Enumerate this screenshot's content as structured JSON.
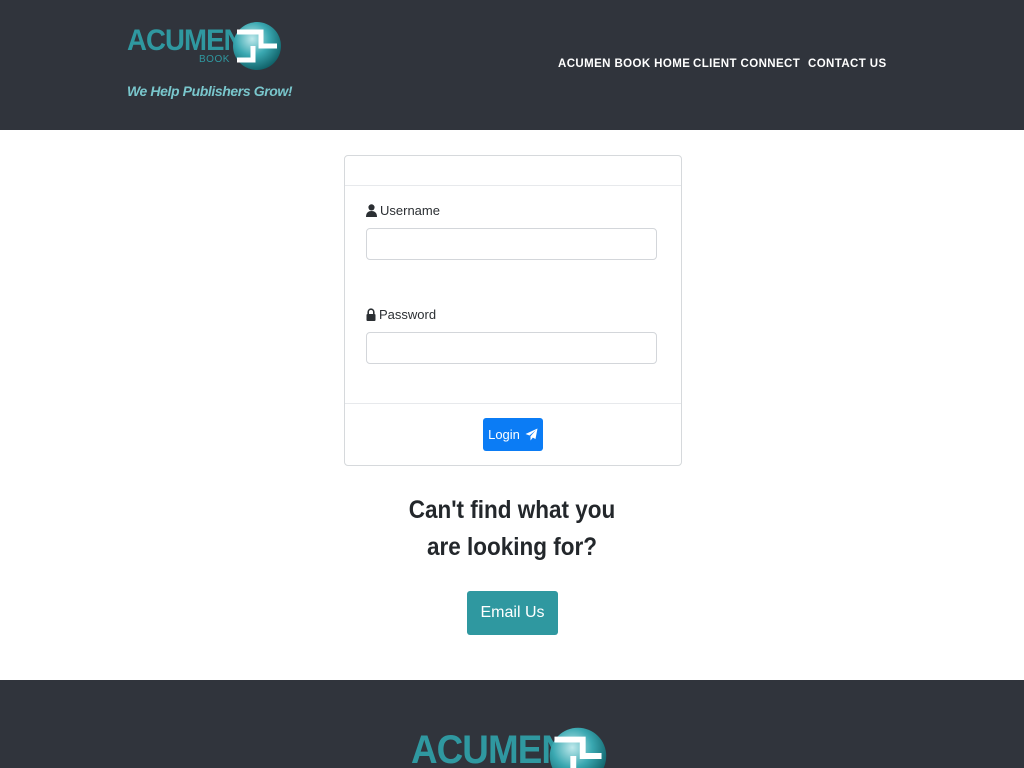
{
  "header": {
    "logo": {
      "word": "ACUMEN",
      "sub": "BOOK",
      "tagline": "We Help Publishers Grow!"
    },
    "nav": [
      {
        "label": "ACUMEN BOOK HOME"
      },
      {
        "label": "CLIENT CONNECT"
      },
      {
        "label": "CONTACT US"
      }
    ]
  },
  "login_form": {
    "username_label": "Username",
    "username_value": "",
    "password_label": "Password",
    "password_value": "",
    "login_label": "Login"
  },
  "cta": {
    "line1": "Can't find what you",
    "line2": "are looking for?",
    "button_label": "Email Us"
  },
  "footer": {
    "logo_word": "ACUMEN"
  },
  "colors": {
    "header_bg": "#30343c",
    "brand_teal": "#2f98a0",
    "login_blue": "#0b7cf5"
  },
  "icons": {
    "username": "user-icon",
    "password": "lock-icon",
    "login": "paper-plane-icon"
  }
}
